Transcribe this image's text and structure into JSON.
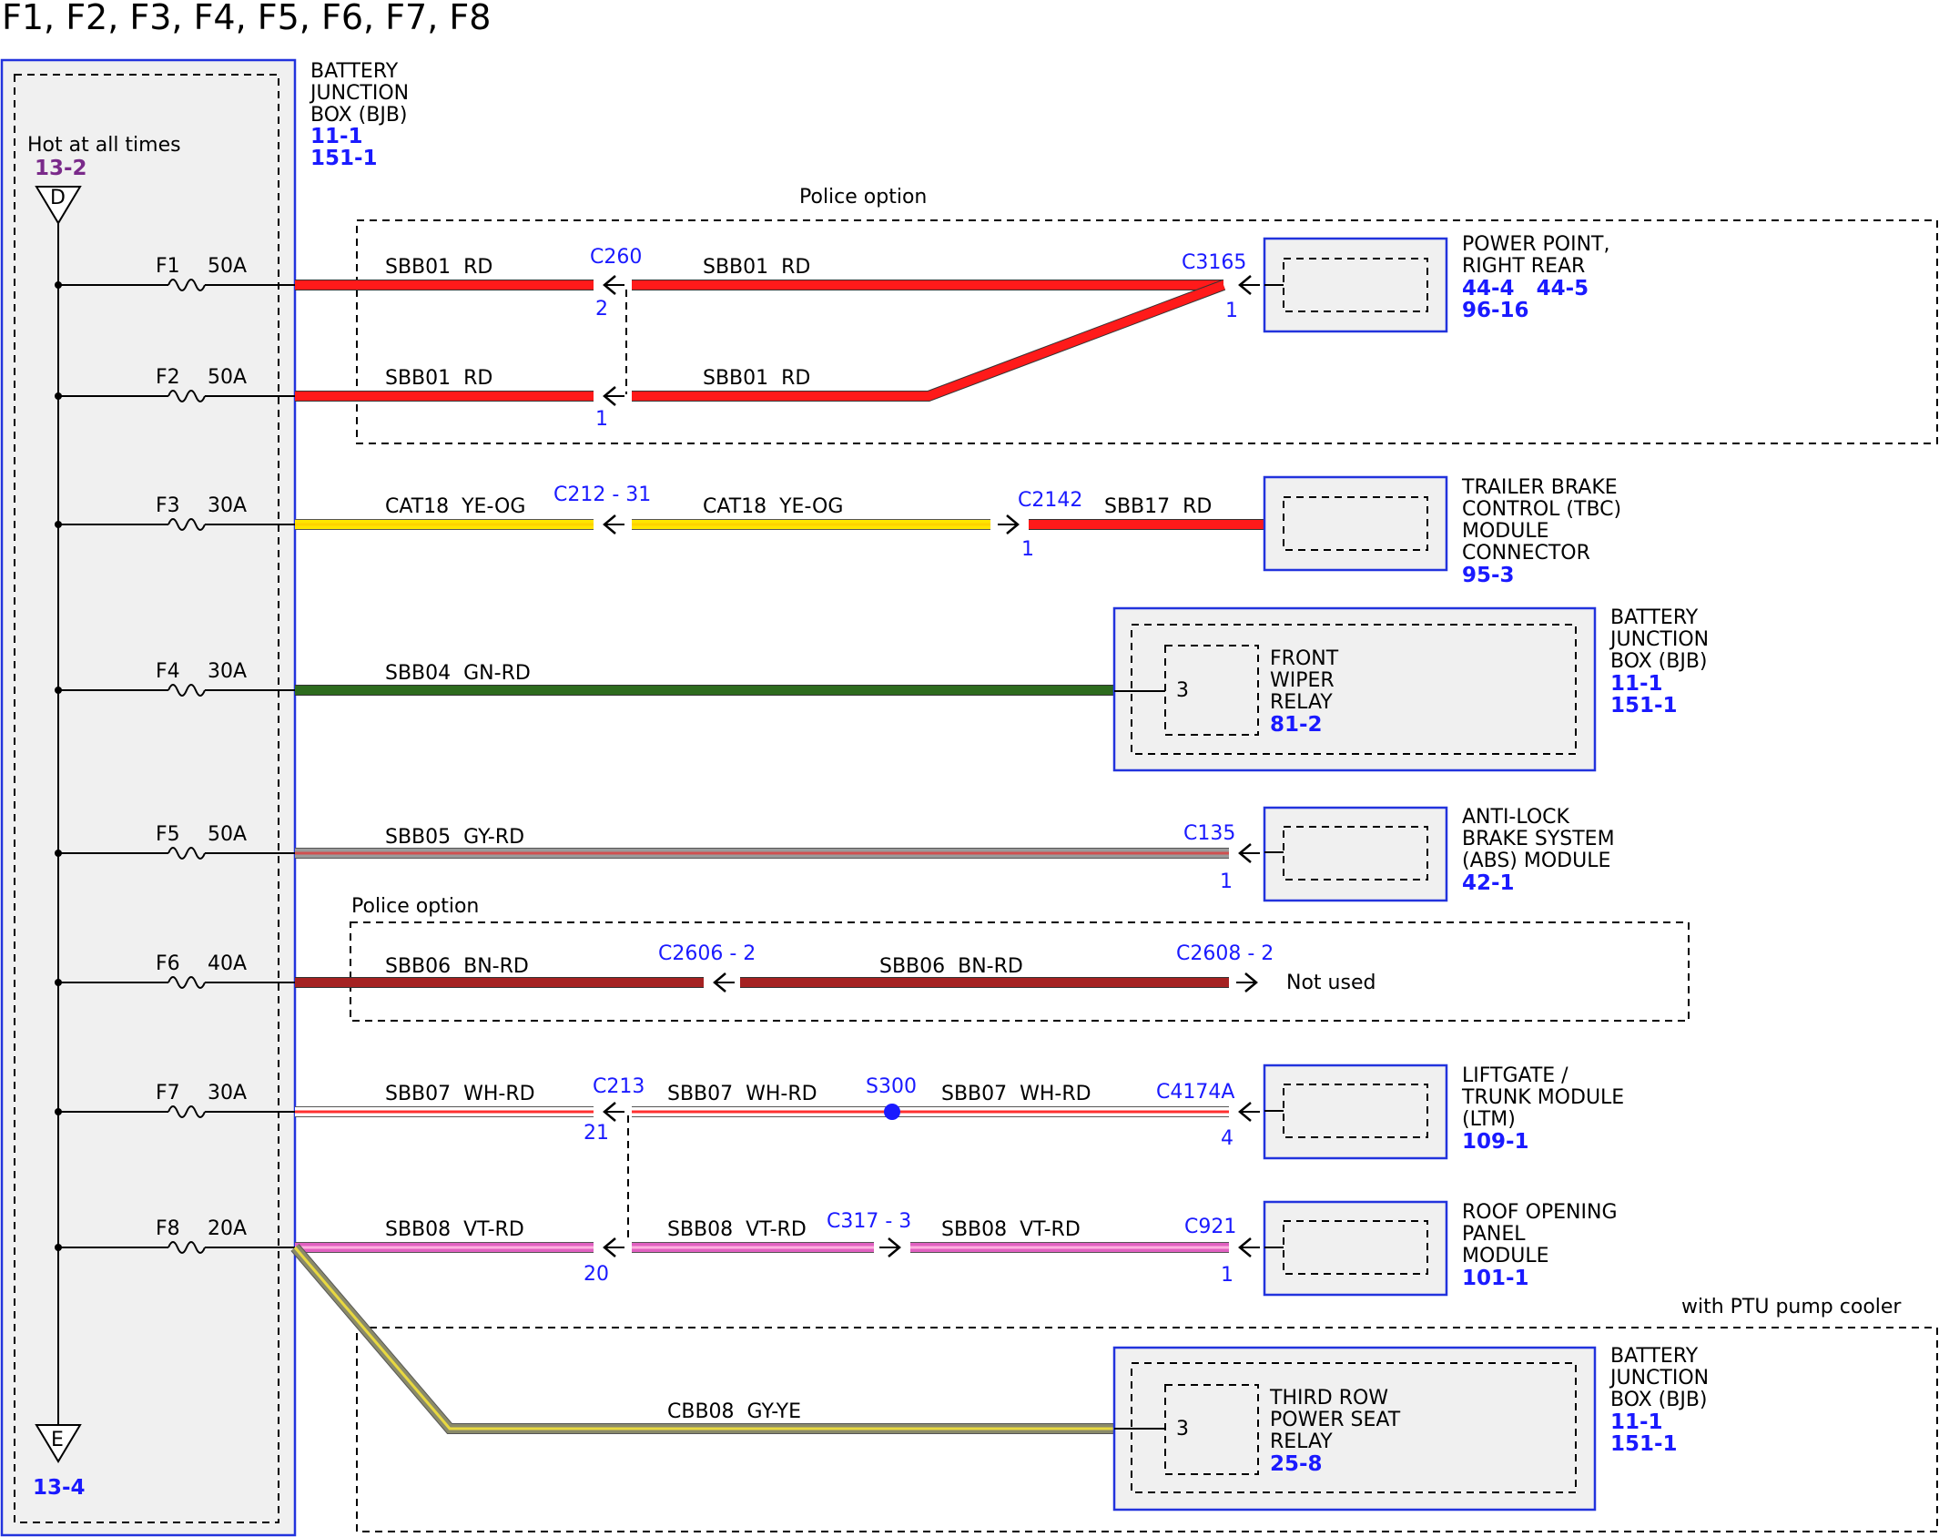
{
  "title": "F1, F2, F3, F4, F5, F6, F7, F8",
  "bjb": {
    "label": [
      "BATTERY",
      "JUNCTION",
      "BOX (BJB)"
    ],
    "refs": [
      "11-1",
      "151-1"
    ],
    "hot_text": "Hot at all times",
    "hot_ref": "13-2",
    "top_connector": "D",
    "bottom_connector": "E",
    "bottom_ref": "13-4"
  },
  "colors": {
    "RD": "#ff1a1a",
    "YE-OG": "#ffe600",
    "GN-RD": "#2d6b1e",
    "GY-RD": "#9a9a9a",
    "BN-RD": "#a52222",
    "WH-RD": "#ffffff",
    "VT-RD": "#e060c0",
    "GY-YE": "#8a8a6a",
    "link_blue": "#1a1aff",
    "box_blue": "#2233dd"
  },
  "fuses": [
    {
      "name": "F1",
      "amps": "50A"
    },
    {
      "name": "F2",
      "amps": "50A"
    },
    {
      "name": "F3",
      "amps": "30A"
    },
    {
      "name": "F4",
      "amps": "30A"
    },
    {
      "name": "F5",
      "amps": "50A"
    },
    {
      "name": "F6",
      "amps": "40A"
    },
    {
      "name": "F7",
      "amps": "30A"
    },
    {
      "name": "F8",
      "amps": "20A"
    }
  ],
  "circuits": {
    "f1_left": "SBB01  RD",
    "f1_right": "SBB01  RD",
    "f2_left": "SBB01  RD",
    "f2_right": "SBB01  RD",
    "f3_a": "CAT18  YE-OG",
    "f3_b": "CAT18  YE-OG",
    "f3_c": "SBB17  RD",
    "f4": "SBB04  GN-RD",
    "f5": "SBB05  GY-RD",
    "f6_left": "SBB06  BN-RD",
    "f6_right": "SBB06  BN-RD",
    "f7_a": "SBB07  WH-RD",
    "f7_b": "SBB07  WH-RD",
    "f7_c": "SBB07  WH-RD",
    "f8_a": "SBB08  VT-RD",
    "f8_b": "SBB08  VT-RD",
    "f8_c": "SBB08  VT-RD",
    "f8_ptu": "CBB08  GY-YE"
  },
  "connectors": {
    "c260": "C260",
    "c260_pin_top": "2",
    "c260_pin_bottom": "1",
    "c3165": "C3165",
    "c3165_pin": "1",
    "c212": "C212 - 31",
    "c2142": "C2142",
    "c2142_pin": "1",
    "c135": "C135",
    "c135_pin": "1",
    "c2606": "C2606 - 2",
    "c2608": "C2608 - 2",
    "c213": "C213",
    "c213_pin_top": "21",
    "c213_pin_bottom": "20",
    "s300": "S300",
    "c4174a": "C4174A",
    "c4174a_pin": "4",
    "c317": "C317 - 3",
    "c921": "C921",
    "c921_pin": "1"
  },
  "options": {
    "police1": "Police option",
    "police2": "Police option",
    "ptu": "with PTU pump cooler",
    "not_used": "Not used"
  },
  "components": {
    "power_point": {
      "label": [
        "POWER POINT,",
        "RIGHT REAR"
      ],
      "refs": [
        "44-4   44-5",
        "96-16"
      ]
    },
    "tbc": {
      "label": [
        "TRAILER BRAKE",
        "CONTROL (TBC)",
        "MODULE",
        "CONNECTOR"
      ],
      "refs": [
        "95-3"
      ]
    },
    "bjb_wiper": {
      "label": [
        "BATTERY",
        "JUNCTION",
        "BOX (BJB)"
      ],
      "refs": [
        "11-1",
        "151-1"
      ],
      "inner_label": [
        "FRONT",
        "WIPER",
        "RELAY"
      ],
      "inner_ref": "81-2",
      "pin": "3"
    },
    "abs": {
      "label": [
        "ANTI-LOCK",
        "BRAKE SYSTEM",
        "(ABS) MODULE"
      ],
      "refs": [
        "42-1"
      ]
    },
    "ltm": {
      "label": [
        "LIFTGATE /",
        "TRUNK MODULE",
        "(LTM)"
      ],
      "refs": [
        "109-1"
      ]
    },
    "roof": {
      "label": [
        "ROOF OPENING",
        "PANEL",
        "MODULE"
      ],
      "refs": [
        "101-1"
      ]
    },
    "bjb_seat": {
      "label": [
        "BATTERY",
        "JUNCTION",
        "BOX (BJB)"
      ],
      "refs": [
        "11-1",
        "151-1"
      ],
      "inner_label": [
        "THIRD ROW",
        "POWER SEAT",
        "RELAY"
      ],
      "inner_ref": "25-8",
      "pin": "3"
    }
  }
}
